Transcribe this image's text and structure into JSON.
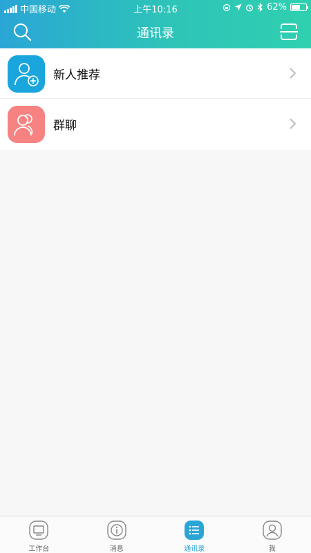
{
  "status_bar": {
    "carrier": "中国移动",
    "time": "上午10:16",
    "battery_percent": "62%",
    "battery_level": 0.62
  },
  "nav": {
    "title": "通讯录",
    "left_icon": "search-icon",
    "right_icon": "scan-icon"
  },
  "contacts": {
    "items": [
      {
        "label": "新人推荐",
        "icon": "add-user-icon",
        "color": "#1aa6dc"
      },
      {
        "label": "群聊",
        "icon": "group-icon",
        "color": "#f68382"
      }
    ]
  },
  "tabs": [
    {
      "label": "工作台",
      "icon": "workbench-icon",
      "active": false
    },
    {
      "label": "消息",
      "icon": "info-icon",
      "active": false
    },
    {
      "label": "通讯录",
      "icon": "contacts-list-icon",
      "active": true
    },
    {
      "label": "我",
      "icon": "profile-icon",
      "active": false
    }
  ],
  "colors": {
    "accent": "#2aa6d6",
    "header_gradient_start": "#2aa6d6",
    "header_gradient_end": "#2fd0b0"
  }
}
